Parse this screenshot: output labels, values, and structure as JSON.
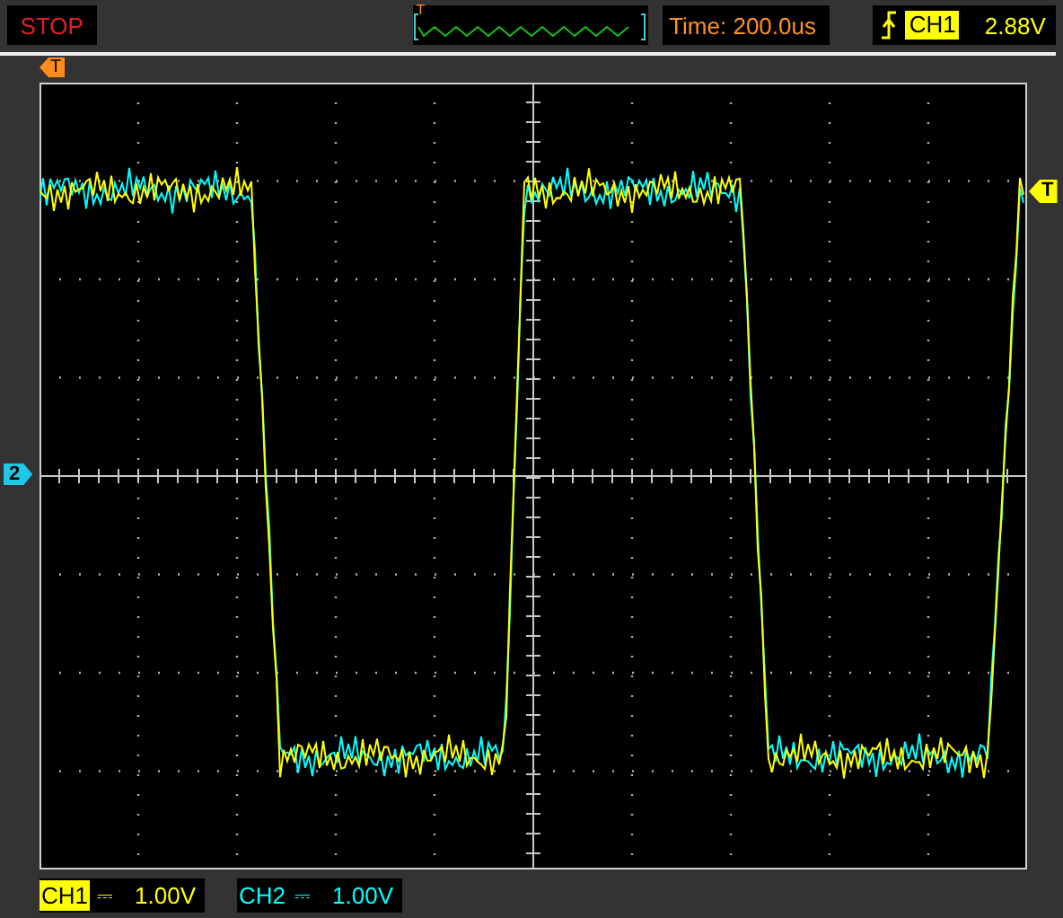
{
  "status": "STOP",
  "overview": {
    "marker": "T"
  },
  "timebase": "Time: 200.0us",
  "trigger": {
    "channel": "CH1",
    "level": "2.88V"
  },
  "trigger_position_marker": "T",
  "trigger_level_marker": "T",
  "ground_marker": "2",
  "channels": [
    {
      "name": "CH1",
      "coupling": "⎓",
      "scale": "1.00V",
      "color": "#ffff00",
      "selected": true
    },
    {
      "name": "CH2",
      "coupling": "⎓",
      "scale": "1.00V",
      "color": "#00ffff",
      "selected": false
    }
  ]
}
